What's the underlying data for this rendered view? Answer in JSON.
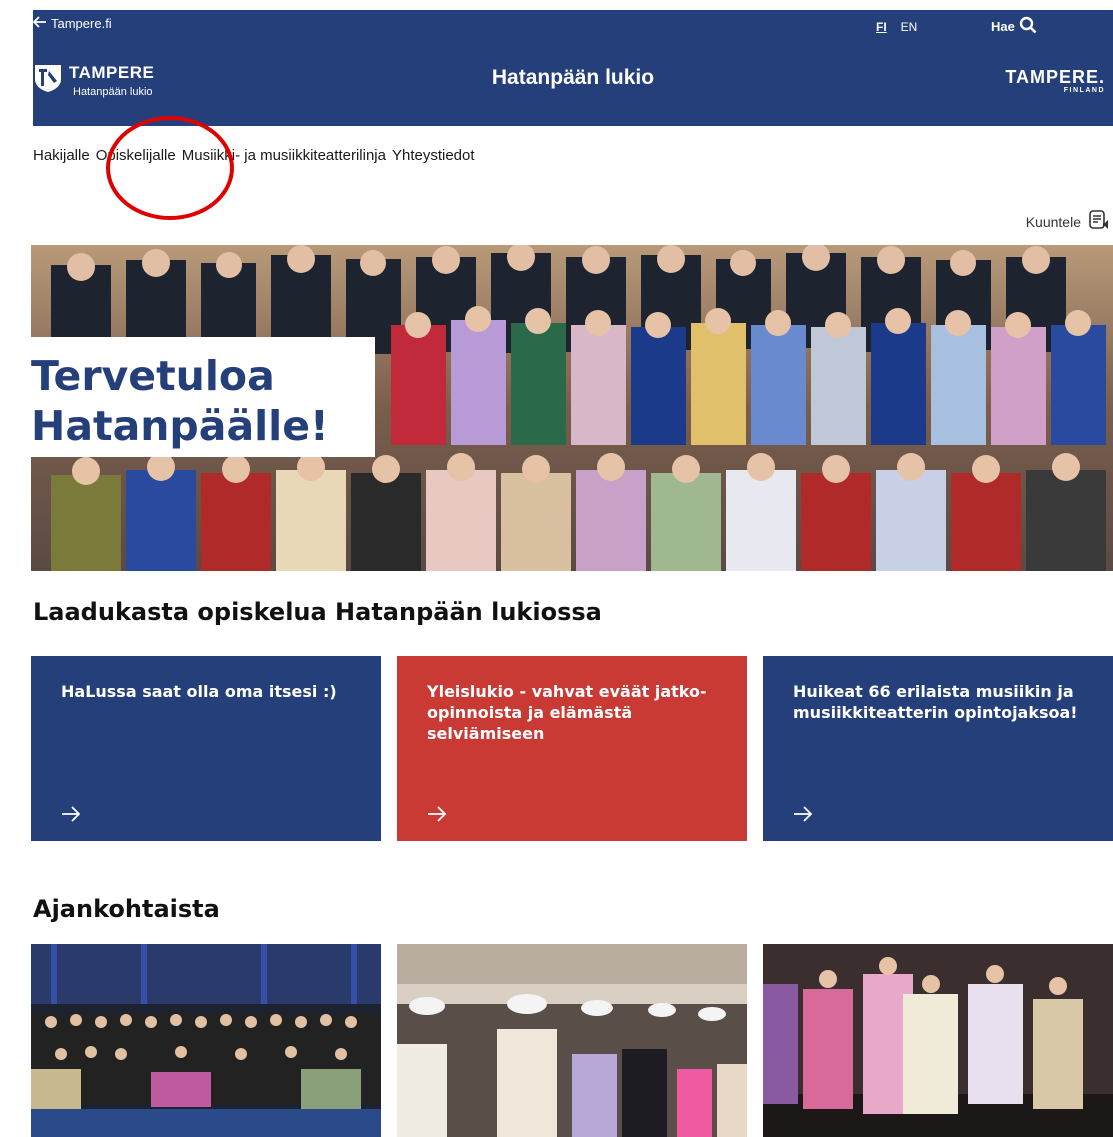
{
  "header": {
    "back_label": "Tampere.fi",
    "lang_fi": "FI",
    "lang_en": "EN",
    "search_label": "Hae",
    "logo_name": "TAMPERE",
    "logo_sub": "Hatanpään lukio",
    "site_title": "Hatanpään lukio",
    "brand_big": "TAMPERE.",
    "brand_small": "FINLAND"
  },
  "nav": {
    "items": [
      {
        "label": "Hakijalle"
      },
      {
        "label": "Opiskelijalle"
      },
      {
        "label": "Musiikki- ja musiikkiteatterilinja"
      },
      {
        "label": "Yhteystiedot"
      }
    ]
  },
  "listen_label": "Kuuntele",
  "hero": {
    "line1": "Tervetuloa",
    "line2": "Hatanpäälle!"
  },
  "sections": {
    "quality_heading": "Laadukasta opiskelua Hatanpään lukiossa",
    "news_heading": "Ajankohtaista"
  },
  "cards": [
    {
      "title": "HaLussa saat olla oma itsesi :)",
      "color": "#253f7a"
    },
    {
      "title": "Yleislukio - vahvat eväät jatko-opinnoista ja elämästä selviämiseen",
      "color": "#c93a35"
    },
    {
      "title": "Huikeat 66 erilaista musiikin ja musiikkiteatterin opintojaksoa!",
      "color": "#253f7a"
    }
  ],
  "colors": {
    "brand_blue": "#253f7a",
    "brand_red": "#c93a35",
    "highlight": "#e00000"
  },
  "icons": {
    "back": "arrow-left-icon",
    "search": "magnifier-icon",
    "listen": "audio-document-icon",
    "card_arrow": "arrow-right-icon"
  }
}
